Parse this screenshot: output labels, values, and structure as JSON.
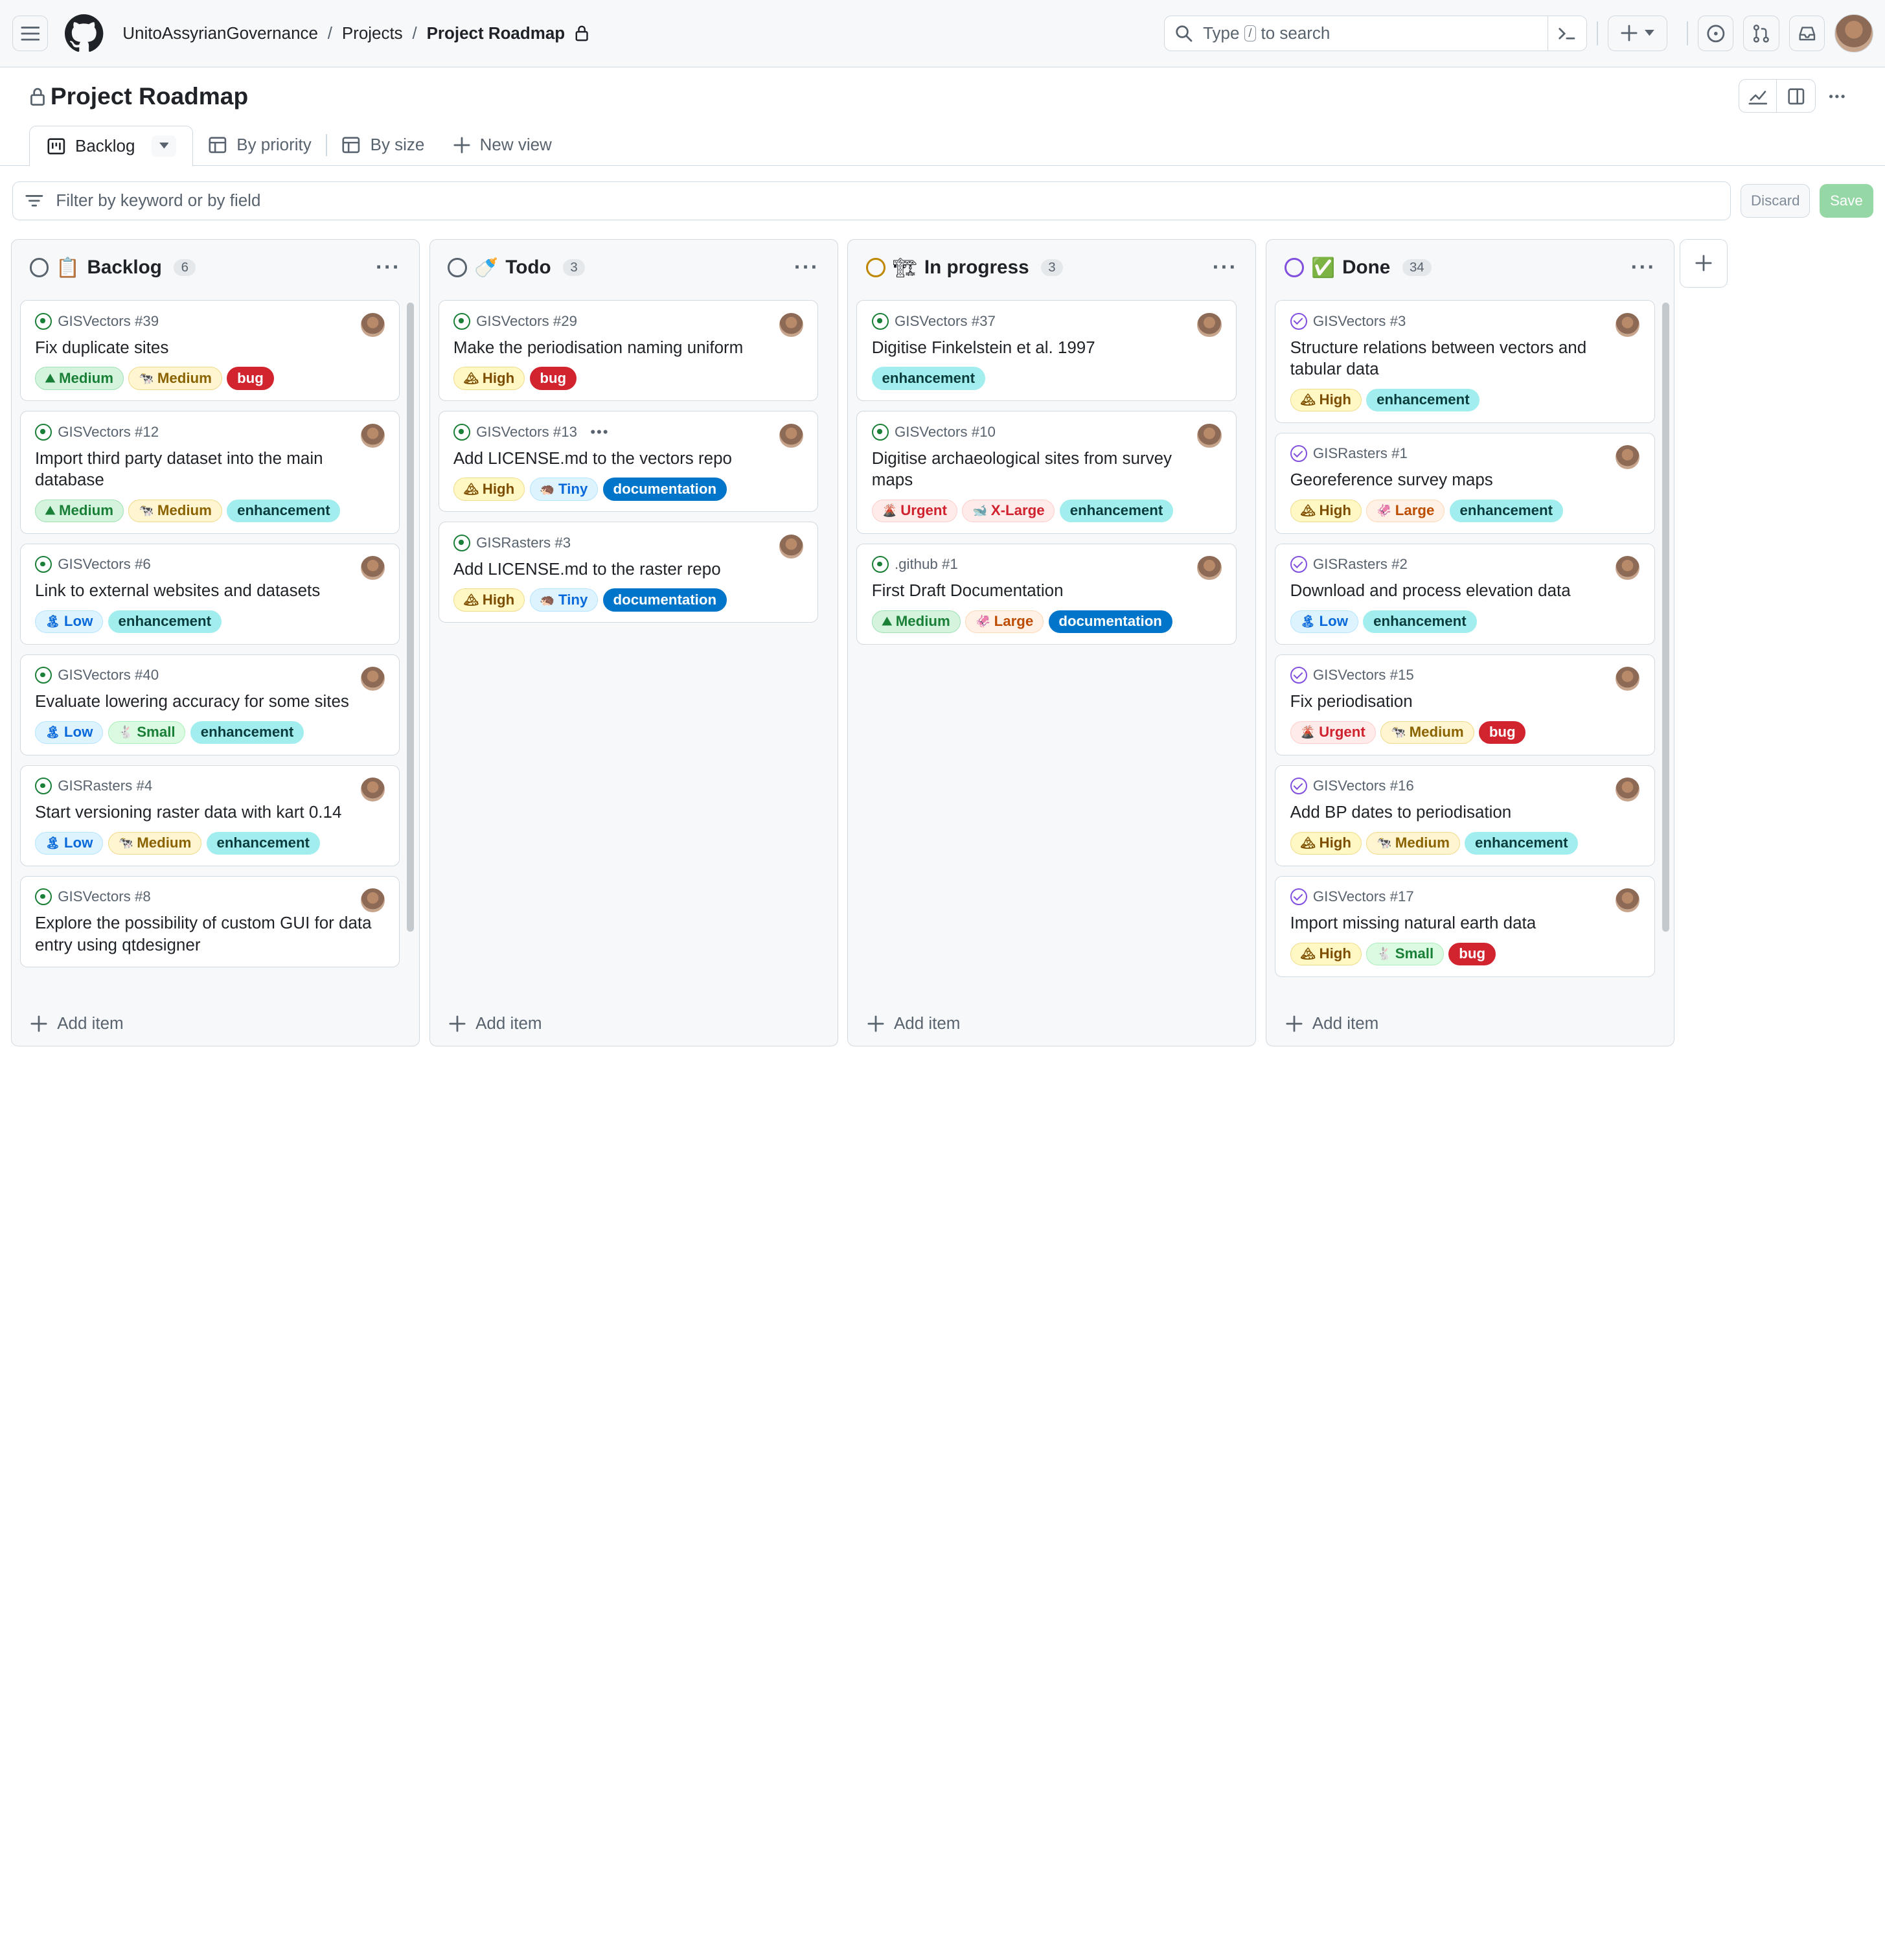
{
  "breadcrumb": {
    "org": "UnitoAssyrianGovernance",
    "projects": "Projects",
    "project": "Project Roadmap",
    "sep": "/"
  },
  "search": {
    "pre": "Type",
    "key": "/",
    "post": "to search"
  },
  "project": {
    "title": "Project Roadmap"
  },
  "views": {
    "backlog": "Backlog",
    "priority": "By priority",
    "size": "By size",
    "new": "New view"
  },
  "filter": {
    "placeholder": "Filter by keyword or by field",
    "discard": "Discard",
    "save": "Save"
  },
  "add_item": "Add item",
  "columns": [
    {
      "name": "Backlog",
      "emoji": "📋",
      "count": "6",
      "status_color": "#59636e",
      "cards": [
        {
          "repo": "GISVectors #39",
          "title": "Fix duplicate sites",
          "closed": false,
          "labels": [
            {
              "t": "Medium",
              "k": "medium",
              "e": "⛰"
            },
            {
              "t": "Medium",
              "k": "medsize",
              "e": "🐄"
            },
            {
              "t": "bug",
              "k": "bug"
            }
          ]
        },
        {
          "repo": "GISVectors #12",
          "title": "Import third party dataset into the main database",
          "closed": false,
          "labels": [
            {
              "t": "Medium",
              "k": "medium",
              "e": "⛰"
            },
            {
              "t": "Medium",
              "k": "medsize",
              "e": "🐄"
            },
            {
              "t": "enhancement",
              "k": "enh"
            }
          ]
        },
        {
          "repo": "GISVectors #6",
          "title": "Link to external websites and datasets",
          "closed": false,
          "labels": [
            {
              "t": "Low",
              "k": "low",
              "e": "🏝"
            },
            {
              "t": "enhancement",
              "k": "enh"
            }
          ]
        },
        {
          "repo": "GISVectors #40",
          "title": "Evaluate lowering accuracy for some sites",
          "closed": false,
          "labels": [
            {
              "t": "Low",
              "k": "low",
              "e": "🏝"
            },
            {
              "t": "Small",
              "k": "small",
              "e": "🐇"
            },
            {
              "t": "enhancement",
              "k": "enh"
            }
          ]
        },
        {
          "repo": "GISRasters #4",
          "title": "Start versioning raster data with kart 0.14",
          "closed": false,
          "labels": [
            {
              "t": "Low",
              "k": "low",
              "e": "🏝"
            },
            {
              "t": "Medium",
              "k": "medsize",
              "e": "🐄"
            },
            {
              "t": "enhancement",
              "k": "enh"
            }
          ]
        },
        {
          "repo": "GISVectors #8",
          "title": "Explore the possibility of custom GUI for data entry using qtdesigner",
          "closed": false,
          "labels": []
        }
      ]
    },
    {
      "name": "Todo",
      "emoji": "🍼",
      "count": "3",
      "status_color": "#59636e",
      "cards": [
        {
          "repo": "GISVectors #29",
          "title": "Make the periodisation naming uniform",
          "closed": false,
          "labels": [
            {
              "t": "High",
              "k": "high",
              "e": "🏔"
            },
            {
              "t": "bug",
              "k": "bug"
            }
          ]
        },
        {
          "repo": "GISVectors #13",
          "title": "Add LICENSE.md to the vectors repo",
          "closed": false,
          "more": "•••",
          "labels": [
            {
              "t": "High",
              "k": "high",
              "e": "🏔"
            },
            {
              "t": "Tiny",
              "k": "tiny",
              "e": "🦔"
            },
            {
              "t": "documentation",
              "k": "doc"
            }
          ]
        },
        {
          "repo": "GISRasters #3",
          "title": "Add LICENSE.md to the raster repo",
          "closed": false,
          "labels": [
            {
              "t": "High",
              "k": "high",
              "e": "🏔"
            },
            {
              "t": "Tiny",
              "k": "tiny",
              "e": "🦔"
            },
            {
              "t": "documentation",
              "k": "doc"
            }
          ]
        }
      ]
    },
    {
      "name": "In progress",
      "emoji": "🏗",
      "count": "3",
      "status_color": "#bf8700",
      "cards": [
        {
          "repo": "GISVectors #37",
          "title": "Digitise Finkelstein et al. 1997",
          "closed": false,
          "labels": [
            {
              "t": "enhancement",
              "k": "enh"
            }
          ]
        },
        {
          "repo": "GISVectors #10",
          "title": "Digitise archaeological sites from survey maps",
          "closed": false,
          "labels": [
            {
              "t": "Urgent",
              "k": "urgent",
              "e": "🌋"
            },
            {
              "t": "X-Large",
              "k": "xlarge",
              "e": "🐋"
            },
            {
              "t": "enhancement",
              "k": "enh"
            }
          ]
        },
        {
          "repo": ".github #1",
          "title": "First Draft Documentation",
          "closed": false,
          "labels": [
            {
              "t": "Medium",
              "k": "medium",
              "e": "⛰"
            },
            {
              "t": "Large",
              "k": "large",
              "e": "🦑"
            },
            {
              "t": "documentation",
              "k": "doc"
            }
          ]
        }
      ]
    },
    {
      "name": "Done",
      "emoji": "✅",
      "count": "34",
      "status_color": "#8250df",
      "cards": [
        {
          "repo": "GISVectors #3",
          "title": "Structure relations between vectors and tabular data",
          "closed": true,
          "labels": [
            {
              "t": "High",
              "k": "high",
              "e": "🏔"
            },
            {
              "t": "enhancement",
              "k": "enh"
            }
          ]
        },
        {
          "repo": "GISRasters #1",
          "title": "Georeference survey maps",
          "closed": true,
          "labels": [
            {
              "t": "High",
              "k": "high",
              "e": "🏔"
            },
            {
              "t": "Large",
              "k": "large",
              "e": "🦑"
            },
            {
              "t": "enhancement",
              "k": "enh"
            }
          ]
        },
        {
          "repo": "GISRasters #2",
          "title": "Download and process elevation data",
          "closed": true,
          "labels": [
            {
              "t": "Low",
              "k": "low",
              "e": "🏝"
            },
            {
              "t": "enhancement",
              "k": "enh"
            }
          ]
        },
        {
          "repo": "GISVectors #15",
          "title": "Fix periodisation",
          "closed": true,
          "labels": [
            {
              "t": "Urgent",
              "k": "urgent",
              "e": "🌋"
            },
            {
              "t": "Medium",
              "k": "medsize",
              "e": "🐄"
            },
            {
              "t": "bug",
              "k": "bug"
            }
          ]
        },
        {
          "repo": "GISVectors #16",
          "title": "Add BP dates to periodisation",
          "closed": true,
          "labels": [
            {
              "t": "High",
              "k": "high",
              "e": "🏔"
            },
            {
              "t": "Medium",
              "k": "medsize",
              "e": "🐄"
            },
            {
              "t": "enhancement",
              "k": "enh"
            }
          ]
        },
        {
          "repo": "GISVectors #17",
          "title": "Import missing natural earth data",
          "closed": true,
          "labels": [
            {
              "t": "High",
              "k": "high",
              "e": "🏔"
            },
            {
              "t": "Small",
              "k": "small",
              "e": "🐇"
            },
            {
              "t": "bug",
              "k": "bug"
            }
          ]
        }
      ]
    }
  ],
  "label_colors": {
    "medium": {
      "bg": "#d4f4de",
      "fg": "#1a7f37",
      "bd": "#9fe0b3"
    },
    "medsize": {
      "bg": "#fff6d1",
      "fg": "#8a6300",
      "bd": "#f0d98a"
    },
    "bug": {
      "bg": "#d1242f",
      "fg": "#ffffff",
      "bd": "#d1242f"
    },
    "enh": {
      "bg": "#a2eeef",
      "fg": "#0a3c3d",
      "bd": "#a2eeef"
    },
    "low": {
      "bg": "#ddf4ff",
      "fg": "#0969da",
      "bd": "#b6e3ff"
    },
    "small": {
      "bg": "#dafbe1",
      "fg": "#1a7f37",
      "bd": "#aceebb"
    },
    "high": {
      "bg": "#fff8c5",
      "fg": "#7d4e00",
      "bd": "#f0dc8a"
    },
    "tiny": {
      "bg": "#ddf4ff",
      "fg": "#0969da",
      "bd": "#b6e3ff"
    },
    "doc": {
      "bg": "#0075ca",
      "fg": "#ffffff",
      "bd": "#0075ca"
    },
    "urgent": {
      "bg": "#ffebe9",
      "fg": "#cf222e",
      "bd": "#ffcecb"
    },
    "xlarge": {
      "bg": "#ffebe9",
      "fg": "#cf222e",
      "bd": "#ffcecb"
    },
    "large": {
      "bg": "#fff1e5",
      "fg": "#bc4c00",
      "bd": "#ffd8b5"
    }
  }
}
